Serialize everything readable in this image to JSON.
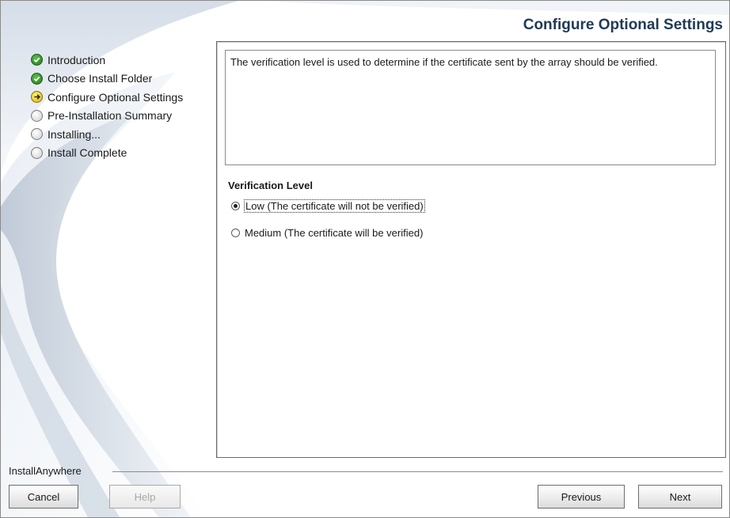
{
  "header": {
    "title": "Configure Optional Settings"
  },
  "steps": [
    {
      "label": "Introduction",
      "status": "done",
      "icon": "check-icon"
    },
    {
      "label": "Choose Install Folder",
      "status": "done",
      "icon": "check-icon"
    },
    {
      "label": "Configure Optional Settings",
      "status": "current",
      "icon": "arrow-icon"
    },
    {
      "label": "Pre-Installation Summary",
      "status": "pending",
      "icon": "circle-icon"
    },
    {
      "label": "Installing...",
      "status": "pending",
      "icon": "circle-icon"
    },
    {
      "label": "Install Complete",
      "status": "pending",
      "icon": "circle-icon"
    }
  ],
  "content": {
    "description": "The verification level is used to determine if the certificate sent by the array should be verified.",
    "section_label": "Verification Level",
    "options": [
      {
        "label": "Low (The certificate will not be verified)",
        "selected": true
      },
      {
        "label": "Medium (The certificate will be verified)",
        "selected": false
      }
    ]
  },
  "footer": {
    "brand": "InstallAnywhere",
    "cancel_label": "Cancel",
    "help_label": "Help",
    "previous_label": "Previous",
    "next_label": "Next"
  },
  "colors": {
    "title": "#203a58",
    "done": "#2e9b22",
    "current": "#f2d21c",
    "pending": "#d4d4d4"
  }
}
